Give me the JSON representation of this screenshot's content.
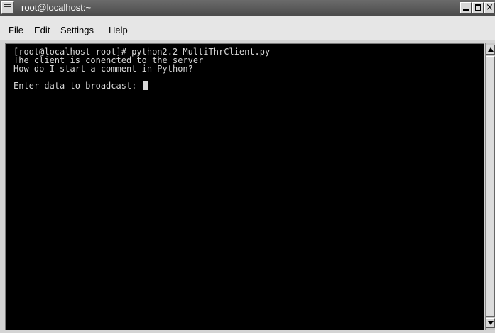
{
  "window": {
    "title": "root@localhost:~"
  },
  "menubar": {
    "items": [
      "File",
      "Edit",
      "Settings",
      "Help"
    ]
  },
  "terminal": {
    "lines": [
      "[root@localhost root]# python2.2 MultiThrClient.py",
      "The client is conencted to the server",
      "How do I start a comment in Python?"
    ],
    "prompt": "Enter data to broadcast: ",
    "background_color": "#000000",
    "text_color": "#d8d8d8"
  },
  "icons": {
    "window_menu": "window-menu-icon",
    "minimize": "minimize-icon",
    "maximize": "maximize-icon",
    "close": "close-icon",
    "scroll_up": "scroll-up-arrow-icon",
    "scroll_down": "scroll-down-arrow-icon"
  }
}
